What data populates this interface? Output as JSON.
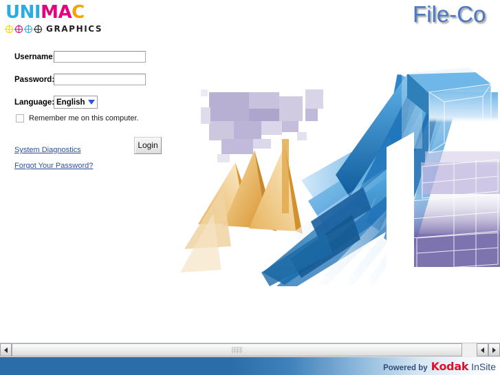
{
  "brand": {
    "word_letters": [
      {
        "char": "U",
        "color": "#2aace2"
      },
      {
        "char": "N",
        "color": "#2aace2"
      },
      {
        "char": "I",
        "color": "#2aace2"
      },
      {
        "char": "M",
        "color": "#e6007e"
      },
      {
        "char": "A",
        "color": "#e6007e"
      },
      {
        "char": "C",
        "color": "#f5a300"
      }
    ],
    "word_text": "UNIMAC",
    "subtitle": "GRAPHICS",
    "reg_marks": [
      {
        "name": "registration-mark-yellow",
        "color": "#ffd400"
      },
      {
        "name": "registration-mark-magenta",
        "color": "#e6007e"
      },
      {
        "name": "registration-mark-cyan",
        "color": "#2aace2"
      },
      {
        "name": "registration-mark-black",
        "color": "#231f20"
      }
    ]
  },
  "header": {
    "product_title": "File-Co",
    "product_title_color": "#4a78c8"
  },
  "login": {
    "fields": [
      {
        "name": "username",
        "label": "Username:",
        "value": "",
        "placeholder": "",
        "type": "text"
      },
      {
        "name": "password",
        "label": "Password:",
        "value": "",
        "placeholder": "",
        "type": "password"
      }
    ],
    "language": {
      "label": "Language:",
      "selected": "English",
      "options": [
        "English"
      ]
    },
    "remember": {
      "label": "Remember me on this computer.",
      "checked": false
    },
    "submit_label": "Login",
    "links": [
      {
        "name": "system-diagnostics",
        "label": "System Diagnostics"
      },
      {
        "name": "forgot-password",
        "label": "Forgot Your Password?"
      }
    ],
    "link_color": "#2a4f9e"
  },
  "artwork": {
    "name": "abstract-3d-geometric-graphic",
    "palette": {
      "blue_dark": "#1d6fb5",
      "blue_mid": "#3c9ade",
      "blue_light": "#9fd2f2",
      "orange": "#e2a23a",
      "orange_light": "#f2cf94",
      "purple": "#8e83b8",
      "purple_light": "#cfc9e4"
    }
  },
  "scrollbar": {
    "orientation": "horizontal",
    "left_arrow": "◀",
    "right_arrow": "▶",
    "thumb_position_percent": 0
  },
  "footer": {
    "powered_by": "Powered by",
    "brand": "Kodak",
    "product": "InSite",
    "brand_color": "#e0102b",
    "text_color": "#2f4e7e",
    "bg_start": "#2a6da8",
    "bg_end": "#ffffff"
  }
}
